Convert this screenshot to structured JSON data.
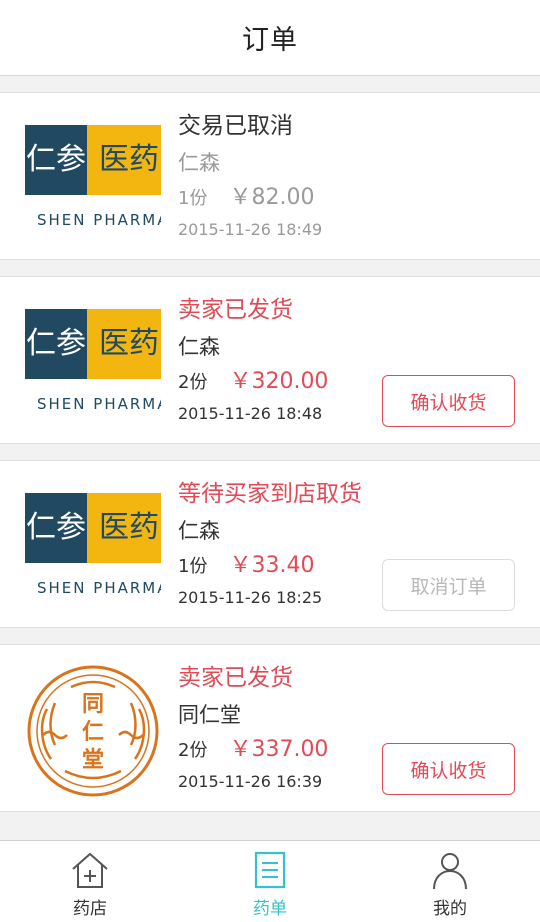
{
  "header": {
    "title": "订单"
  },
  "orders": [
    {
      "status": "交易已取消",
      "shop": "仁森",
      "qty": "1份",
      "price": "￥82.00",
      "time": "2015-11-26 18:49",
      "logo": "shen-pharma",
      "action": ""
    },
    {
      "status": "卖家已发货",
      "shop": "仁森",
      "qty": "2份",
      "price": "￥320.00",
      "time": "2015-11-26 18:48",
      "logo": "shen-pharma",
      "action": "确认收货"
    },
    {
      "status": "等待买家到店取货",
      "shop": "仁森",
      "qty": "1份",
      "price": "￥33.40",
      "time": "2015-11-26 18:25",
      "logo": "shen-pharma",
      "action": "取消订单"
    },
    {
      "status": "卖家已发货",
      "shop": "同仁堂",
      "qty": "2份",
      "price": "￥337.00",
      "time": "2015-11-26 16:39",
      "logo": "tongrentang-seal",
      "action": "确认收货"
    }
  ],
  "logos": {
    "shen": {
      "cn1": "仁参",
      "cn2": "医药",
      "en": "SHEN PHARMA"
    },
    "trt": {
      "chars": [
        "同",
        "仁",
        "堂"
      ]
    }
  },
  "tabs": [
    {
      "label": "药店",
      "icon": "home-icon",
      "active": false
    },
    {
      "label": "药单",
      "icon": "list-icon",
      "active": true
    },
    {
      "label": "我的",
      "icon": "user-icon",
      "active": false
    }
  ],
  "colors": {
    "accent_red": "#e34a57",
    "tab_active": "#35c2c8",
    "logo_yellow": "#f3b50f",
    "logo_navy": "#214a62",
    "seal_orange": "#d9731c"
  }
}
